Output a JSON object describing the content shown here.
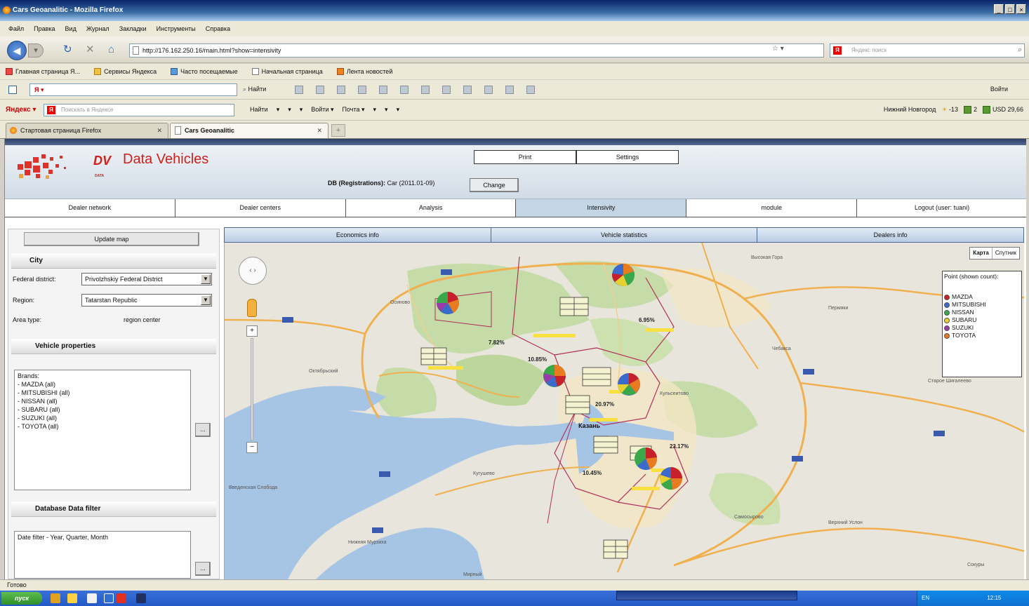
{
  "window": {
    "title": "Cars Geoanalitic - Mozilla Firefox",
    "controls": [
      "_",
      "□",
      "×"
    ]
  },
  "menu": [
    "Файл",
    "Правка",
    "Вид",
    "Журнал",
    "Закладки",
    "Инструменты",
    "Справка"
  ],
  "nav": {
    "url": "http://176.162.250.16/main.html?show=intensivity",
    "search_placeholder": "Яндекс поиск",
    "star": "☆ ▾ &amp; ▾"
  },
  "bookmarks": [
    "Главная страница Я...",
    "Сервисы Яндекса",
    "Часто посещаемые",
    "Начальная страница",
    "Лента новостей"
  ],
  "toolbar1": {
    "ya": "Я ▾",
    "find": "Найти",
    "login": "Войти"
  },
  "toolbar2": {
    "label": "Яндекс ▾",
    "placeholder": "Поискать в Яндексе",
    "items": [
      "Найти",
      "▾",
      "▾",
      "▾",
      "Войти ▾",
      "Почта ▾",
      "▾",
      "▾",
      "▾"
    ],
    "location": "Нижний Новгород",
    "weather": "-13",
    "traffic": "2",
    "currency": "USD 29,66"
  },
  "tabs": [
    {
      "label": "Стартовая страница Firefox"
    },
    {
      "label": "Cars Geoanalitic"
    }
  ],
  "app": {
    "brand": "Data Vehicles",
    "logo_small": "DV",
    "logo_sub": "DATA",
    "print_label": "Print",
    "settings_label": "Settings",
    "db_prefix": "DB (Registrations):",
    "db_value": "Car (2011.01-09)",
    "change_label": "Change",
    "nav": [
      "Dealer network",
      "Dealer centers",
      "Analysis",
      "Intensivity",
      "module",
      "Logout (user: tuani)"
    ],
    "active_nav": "Intensivity"
  },
  "left": {
    "update_label": "Update map",
    "city_header": "City",
    "federal_label": "Federal district:",
    "federal_value": "Privolzhskiy Federal District",
    "region_label": "Region:",
    "region_value": "Tatarstan Republic",
    "area_label": "Area type:",
    "area_value": "region center",
    "vehicle_header": "Vehicle properties",
    "brands_title": "Brands:",
    "brands": [
      "- MAZDA (all)",
      "- MITSUBISHI (all)",
      "- NISSAN (all)",
      "- SUBARU (all)",
      "- SUZUKI (all)",
      "- TOYOTA (all)"
    ],
    "ellipsis": "...",
    "db_filter_header": "Database Data filter",
    "date_filter": "Date filter - Year, Quarter, Month"
  },
  "map": {
    "tabs": [
      "Economics info",
      "Vehicle statistics",
      "Dealers info"
    ],
    "type_map": "Карта",
    "type_sat": "Спутник",
    "legend_title": "Point (shown count):",
    "legend": [
      {
        "name": "MAZDA",
        "color": "#c8202a"
      },
      {
        "name": "MITSUBISHI",
        "color": "#3a6acc"
      },
      {
        "name": "NISSAN",
        "color": "#3aa84a"
      },
      {
        "name": "SUBARU",
        "color": "#e8d030"
      },
      {
        "name": "SUZUKI",
        "color": "#9a3aa8"
      },
      {
        "name": "TOYOTA",
        "color": "#e87a20"
      }
    ],
    "percents": [
      "7.82%",
      "6.95%",
      "10.85%",
      "20.97%",
      "23.17%",
      "10.45%"
    ],
    "city_label": "Казань",
    "place_labels": [
      "Осиново",
      "Октябрьский",
      "Высокая Гора",
      "Пермяки",
      "Чебакса",
      "Старое Шигалеево",
      "Верхний Услон",
      "Введенская Слобода",
      "Нижняя Мурзиха",
      "Сокуры",
      "Кульсеитово",
      "Самосырово",
      "Кугушево",
      "Мирный"
    ],
    "zoom_in": "+",
    "zoom_out": "−"
  },
  "status": {
    "text": "Готово"
  },
  "taskbar": {
    "start": "пуск",
    "lang": "EN",
    "clock": "12:15"
  }
}
